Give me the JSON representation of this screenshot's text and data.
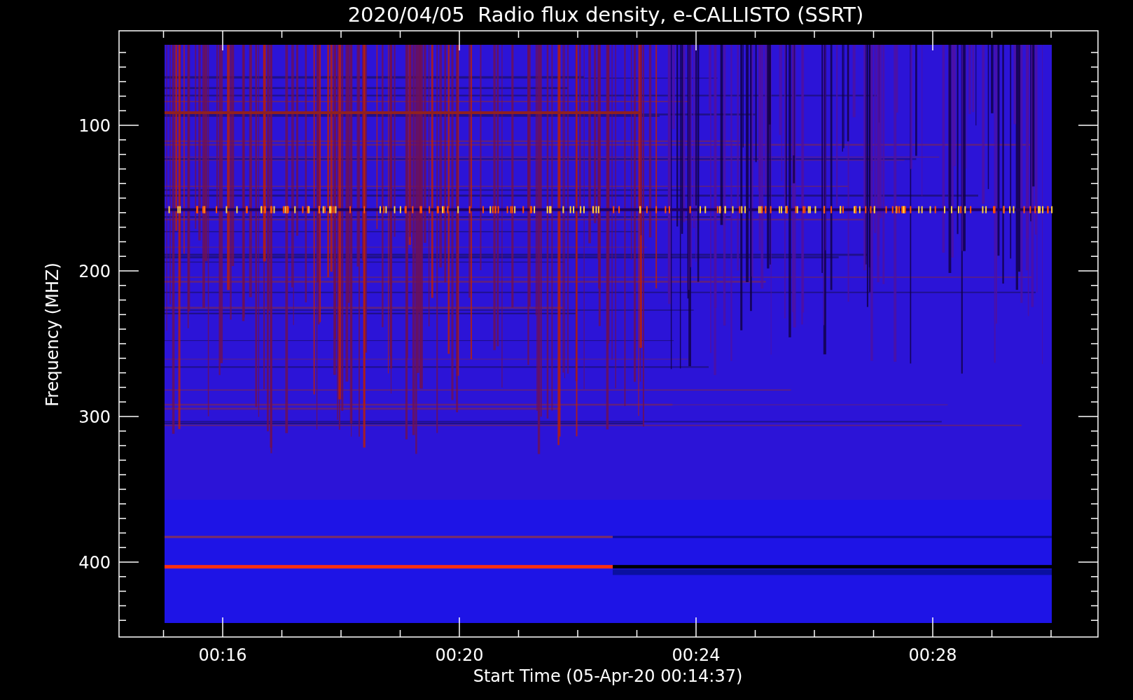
{
  "title": "2020/04/05  Radio flux density, e-CALLISTO (SSRT)",
  "ylabel": "Frequency (MHZ)",
  "xlabel": "Start Time (05-Apr-20 00:14:37)",
  "yticks": [
    "100",
    "200",
    "300",
    "400"
  ],
  "xticks": [
    "00:16",
    "00:20",
    "00:24",
    "00:28"
  ]
}
